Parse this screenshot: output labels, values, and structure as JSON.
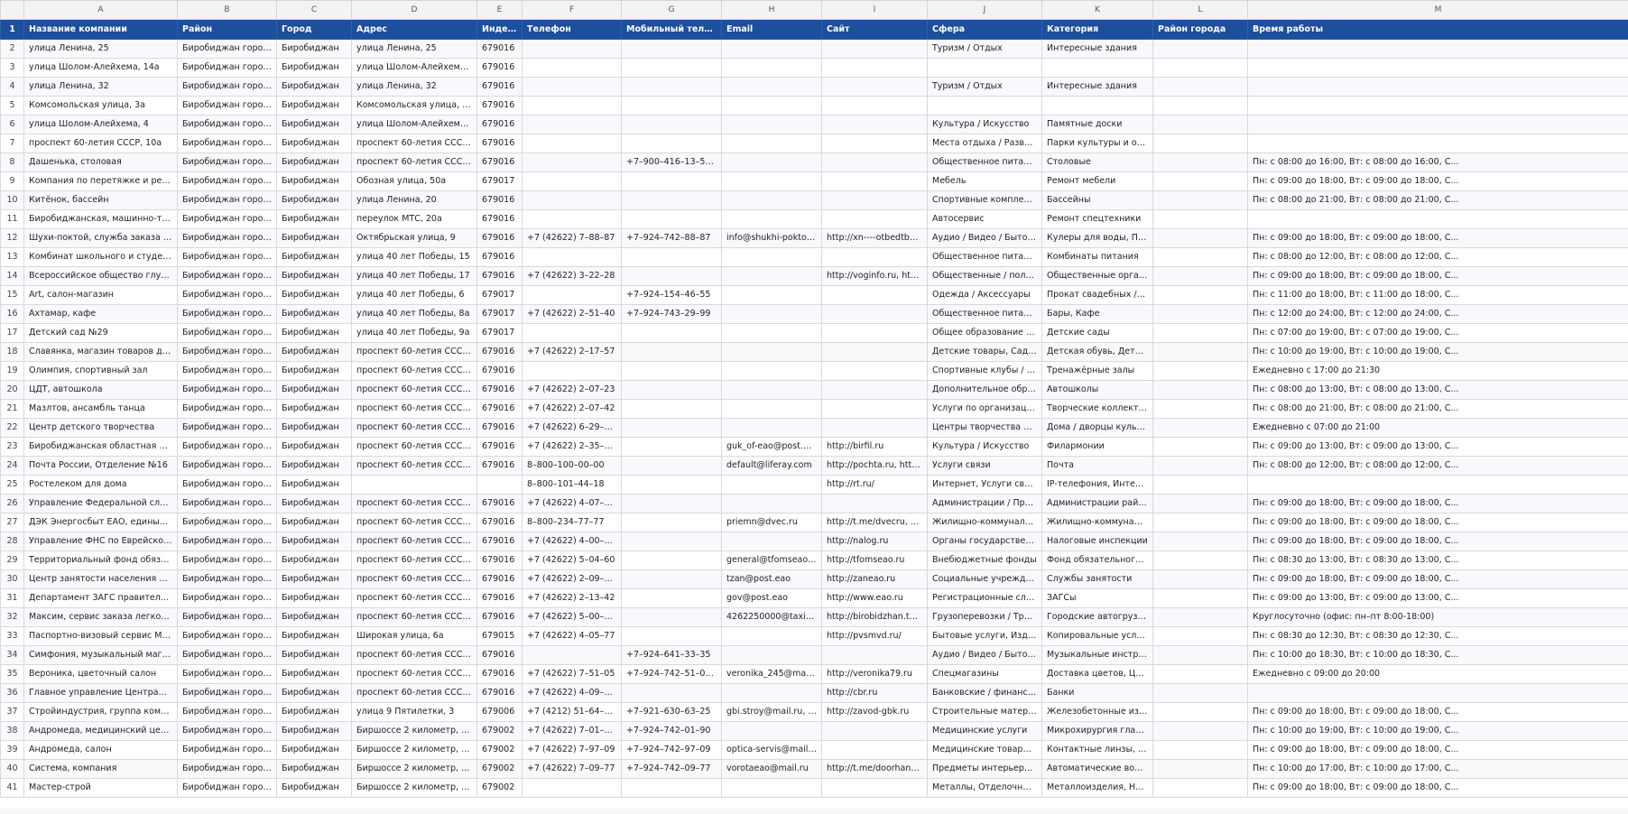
{
  "column_letters": [
    "A",
    "B",
    "C",
    "D",
    "E",
    "F",
    "G",
    "H",
    "I",
    "J",
    "K",
    "L",
    "M"
  ],
  "header_row": {
    "row_number": "1",
    "cells": [
      "Название компании",
      "Район",
      "Город",
      "Адрес",
      "Индекс",
      "Телефон",
      "Мобильный телефон",
      "Email",
      "Сайт",
      "Сфера",
      "Категория",
      "Район города",
      "Время работы"
    ]
  },
  "rows": [
    {
      "n": "2",
      "c": [
        "улица Ленина, 25",
        "Биробиджан городско...",
        "Биробиджан",
        "улица Ленина, 25",
        "679016",
        "",
        "",
        "",
        "",
        "Туризм / Отдых",
        "Интересные здания",
        "",
        ""
      ]
    },
    {
      "n": "3",
      "c": [
        "улица Шолом-Алейхема, 14а",
        "Биробиджан городско...",
        "Биробиджан",
        "улица Шолом-Алейхема, 14а",
        "679016",
        "",
        "",
        "",
        "",
        "",
        "",
        "",
        ""
      ]
    },
    {
      "n": "4",
      "c": [
        "улица Ленина, 32",
        "Биробиджан городско...",
        "Биробиджан",
        "улица Ленина, 32",
        "679016",
        "",
        "",
        "",
        "",
        "Туризм / Отдых",
        "Интересные здания",
        "",
        ""
      ]
    },
    {
      "n": "5",
      "c": [
        "Комсомольская улица, 3а",
        "Биробиджан городско...",
        "Биробиджан",
        "Комсомольская улица, 3а",
        "679016",
        "",
        "",
        "",
        "",
        "",
        "",
        "",
        ""
      ]
    },
    {
      "n": "6",
      "c": [
        "улица Шолом-Алейхема, 4",
        "Биробиджан городско...",
        "Биробиджан",
        "улица Шолом-Алейхема, 4",
        "679016",
        "",
        "",
        "",
        "",
        "Культура / Искусство",
        "Памятные доски",
        "",
        ""
      ]
    },
    {
      "n": "7",
      "c": [
        "проспект 60-летия СССР, 10а",
        "Биробиджан городско...",
        "Биробиджан",
        "проспект 60-летия СССР, 10а",
        "679016",
        "",
        "",
        "",
        "",
        "Места отдыха / Развлекате...",
        "Парки культуры и отдыха",
        "",
        ""
      ]
    },
    {
      "n": "8",
      "c": [
        "Дашенька, столовая",
        "Биробиджан городско...",
        "Биробиджан",
        "проспект 60-летия СССР, 12",
        "679016",
        "",
        "+7–900–416–13–58, +7...",
        "",
        "",
        "Общественное питание",
        "Столовые",
        "",
        "Пн: с 08:00 до 16:00, Вт: с 08:00 до 16:00, С..."
      ]
    },
    {
      "n": "9",
      "c": [
        "Компания по перетяжке и ремонту м...",
        "Биробиджан городско...",
        "Биробиджан",
        "Обозная улица, 50а",
        "679017",
        "",
        "",
        "",
        "",
        "Мебель",
        "Ремонт мебели",
        "",
        "Пн: с 09:00 до 18:00, Вт: с 09:00 до 18:00, С..."
      ]
    },
    {
      "n": "10",
      "c": [
        "Китёнок, бассейн",
        "Биробиджан городско...",
        "Биробиджан",
        "улица Ленина, 20",
        "679016",
        "",
        "",
        "",
        "",
        "Спортивные комплексы",
        "Бассейны",
        "",
        "Пн: с 08:00 до 21:00, Вт: с 08:00 до 21:00, С..."
      ]
    },
    {
      "n": "11",
      "c": [
        "Биробиджанская, машинно-технолог...",
        "Биробиджан городско...",
        "Биробиджан",
        "переулок МТС, 20а",
        "679016",
        "",
        "",
        "",
        "",
        "Автосервис",
        "Ремонт спецтехники",
        "",
        ""
      ]
    },
    {
      "n": "12",
      "c": [
        "Шухи-поктой, служба заказа артезиа...",
        "Биробиджан городско...",
        "Биробиджан",
        "Октябрьская улица, 9",
        "679016",
        "+7 (42622) 7–88–87",
        "+7–924–742–88–87",
        "info@shukhi-poktoi.ru, ...",
        "http://xn----otbedtbe0ad...",
        "Аудио / Видео / Бытовая т...",
        "Кулеры для воды, Питьева...",
        "",
        "Пн: с 09:00 до 18:00, Вт: с 09:00 до 18:00, С..."
      ]
    },
    {
      "n": "13",
      "c": [
        "Комбинат школьного и студенческог...",
        "Биробиджан городско...",
        "Биробиджан",
        "улица 40 лет Победы, 15",
        "679016",
        "",
        "",
        "",
        "",
        "Общественное питание",
        "Комбинаты питания",
        "",
        "Пн: с 08:00 до 12:00, Вт: с 08:00 до 12:00, С..."
      ]
    },
    {
      "n": "14",
      "c": [
        "Всероссийское общество глухих",
        "Биробиджан городско...",
        "Биробиджан",
        "улица 40 лет Победы, 17",
        "679016",
        "+7 (42622) 3–22–28",
        "",
        "",
        "http://voginfo.ru, http://v...",
        "Общественные / политиче...",
        "Общественные организац...",
        "",
        "Пн: с 09:00 до 18:00, Вт: с 09:00 до 18:00, С..."
      ]
    },
    {
      "n": "15",
      "c": [
        "Art, салон-магазин",
        "Биробиджан городско...",
        "Биробиджан",
        "улица 40 лет Победы, 6",
        "679017",
        "",
        "+7–924–154–46–55",
        "",
        "",
        "Одежда / Аксессуары",
        "Прокат свадебных / вечер...",
        "",
        "Пн: с 11:00 до 18:00, Вт: с 11:00 до 18:00, С..."
      ]
    },
    {
      "n": "16",
      "c": [
        "Ахтамар, кафе",
        "Биробиджан городско...",
        "Биробиджан",
        "улица 40 лет Победы, 8а",
        "679017",
        "+7 (42622) 2–51–40",
        "+7–924–743–29–99",
        "",
        "",
        "Общественное питание",
        "Бары, Кафе",
        "",
        "Пн: с 12:00 до 24:00, Вт: с 12:00 до 24:00, С..."
      ]
    },
    {
      "n": "17",
      "c": [
        "Детский сад №29",
        "Биробиджан городско...",
        "Биробиджан",
        "улица 40 лет Победы, 9а",
        "679017",
        "",
        "",
        "",
        "",
        "Общее образование / Цен...",
        "Детские сады",
        "",
        "Пн: с 07:00 до 19:00, Вт: с 07:00 до 19:00, С..."
      ]
    },
    {
      "n": "18",
      "c": [
        "Славянка, магазин товаров для дома",
        "Биробиджан городско...",
        "Биробиджан",
        "проспект 60-летия СССР, 11",
        "679016",
        "+7 (42622) 2–17–57",
        "",
        "",
        "",
        "Детские товары, Садово-х...",
        "Детская обувь, Детская од...",
        "",
        "Пн: с 10:00 до 19:00, Вт: с 10:00 до 19:00, С..."
      ]
    },
    {
      "n": "19",
      "c": [
        "Олимпия, спортивный зал",
        "Биробиджан городско...",
        "Биробиджан",
        "проспект 60-летия СССР, 11",
        "679016",
        "",
        "",
        "",
        "",
        "Спортивные клубы / школы",
        "Тренажёрные залы",
        "",
        "Ежедневно с 17:00 до 21:30"
      ]
    },
    {
      "n": "20",
      "c": [
        "ЦДТ, автошкола",
        "Биробиджан городско...",
        "Биробиджан",
        "проспект 60-летия СССР, 12",
        "679016",
        "+7 (42622) 2–07–23",
        "",
        "",
        "",
        "Дополнительное образов...",
        "Автошколы",
        "",
        "Пн: с 08:00 до 13:00, Вт: с 08:00 до 13:00, С..."
      ]
    },
    {
      "n": "21",
      "c": [
        "Мазлтов, ансамбль танца",
        "Биробиджан городско...",
        "Биробиджан",
        "проспект 60-летия СССР, 12",
        "679016",
        "+7 (42622) 2–07–42",
        "",
        "",
        "",
        "Услуги по организации пр...",
        "Творческие коллективы",
        "",
        "Пн: с 08:00 до 21:00, Вт: с 08:00 до 21:00, С..."
      ]
    },
    {
      "n": "22",
      "c": [
        "Центр детского творчества",
        "Биробиджан городско...",
        "Биробиджан",
        "проспект 60-летия СССР, 12",
        "679016",
        "+7 (42622) 6–29–42, +7...",
        "",
        "",
        "",
        "Центры творчества и досуга",
        "Дома / дворцы культуры",
        "",
        "Ежедневно с 07:00 до 21:00"
      ]
    },
    {
      "n": "23",
      "c": [
        "Биробиджанская областная филармо...",
        "Биробиджан городско...",
        "Биробиджан",
        "проспект 60-летия СССР, 14",
        "679016",
        "+7 (42622) 2–35–36, +7...",
        "",
        "guk_of-eao@post.eao, ...",
        "http://birfil.ru",
        "Культура / Искусство",
        "Филармонии",
        "",
        "Пн: с 09:00 до 13:00, Вт: с 09:00 до 13:00, С..."
      ]
    },
    {
      "n": "24",
      "c": [
        "Почта России, Отделение №16",
        "Биробиджан городско...",
        "Биробиджан",
        "проспект 60-летия СССР, 16",
        "679016",
        "8–800–100–00–00",
        "",
        "default@liferay.com",
        "http://pochta.ru, http://po...",
        "Услуги связи",
        "Почта",
        "",
        "Пн: с 08:00 до 12:00, Вт: с 08:00 до 12:00, С..."
      ]
    },
    {
      "n": "25",
      "c": [
        "Ростелеком для дома",
        "Биробиджан городско...",
        "Биробиджан",
        "",
        "",
        "8–800–101–44–18",
        "",
        "",
        "http://rt.ru/",
        "Интернет, Услуги связи",
        "IP-телефония, Интернет-п...",
        "",
        ""
      ]
    },
    {
      "n": "26",
      "c": [
        "Управление Федеральной службы по ...",
        "Биробиджан городско...",
        "Биробиджан",
        "проспект 60-летия СССР, 16",
        "679016",
        "+7 (42622) 4–07–12, +7...",
        "",
        "",
        "",
        "Администрации / Правите...",
        "Администрации районов /...",
        "",
        "Пн: с 09:00 до 18:00, Вт: с 09:00 до 18:00, С..."
      ]
    },
    {
      "n": "27",
      "c": [
        "ДЭК Энергосбыт ЕАО, единый расчет...",
        "Биробиджан городско...",
        "Биробиджан",
        "проспект 60-летия СССР, 22а",
        "679016",
        "8–800–234–77–77",
        "",
        "priemn@dvec.ru",
        "http://t.me/dvecru, http://...",
        "Жилищно-коммунальные ...",
        "Жилищно-коммунальные ...",
        "",
        "Пн: с 09:00 до 18:00, Вт: с 09:00 до 18:00, С..."
      ]
    },
    {
      "n": "28",
      "c": [
        "Управление ФНС по Еврейской автон...",
        "Биробиджан городско...",
        "Биробиджан",
        "проспект 60-летия СССР, 24",
        "679016",
        "+7 (42622) 4–00–67, +7...",
        "",
        "",
        "http://nalog.ru",
        "Органы государственного ...",
        "Налоговые инспекции",
        "",
        "Пн: с 09:00 до 18:00, Вт: с 09:00 до 18:00, С..."
      ]
    },
    {
      "n": "29",
      "c": [
        "Территориальный фонд обязательно...",
        "Биробиджан городско...",
        "Биробиджан",
        "проспект 60-летия СССР, 24",
        "679016",
        "+7 (42622) 5–04–60",
        "",
        "general@tfomseao.ru, tf...",
        "http://tfomseao.ru",
        "Внебюджетные фонды",
        "Фонд обязательного меди...",
        "",
        "Пн: с 08:30 до 13:00, Вт: с 08:30 до 13:00, С..."
      ]
    },
    {
      "n": "30",
      "c": [
        "Центр занятости населения Еврейско...",
        "Биробиджан городско...",
        "Биробиджан",
        "проспект 60-летия СССР, 24",
        "679016",
        "+7 (42622) 2–09–63, +7...",
        "",
        "tzan@post.eao",
        "http://zaneao.ru",
        "Социальные учреждения",
        "Службы занятости",
        "",
        "Пн: с 09:00 до 18:00, Вт: с 09:00 до 18:00, С..."
      ]
    },
    {
      "n": "31",
      "c": [
        "Департамент ЗАГС правительства Евр...",
        "Биробиджан городско...",
        "Биробиджан",
        "проспект 60-летия СССР, 26",
        "679016",
        "+7 (42622) 2–13–42",
        "",
        "gov@post.eao",
        "http://www.eao.ru",
        "Регистрационные службы",
        "ЗАГСы",
        "",
        "Пн: с 09:00 до 13:00, Вт: с 09:00 до 13:00, С..."
      ]
    },
    {
      "n": "32",
      "c": [
        "Максим, сервис заказа легкового и гр...",
        "Биробиджан городско...",
        "Биробиджан",
        "проспект 60-летия СССР, 3",
        "679016",
        "+7 (42622) 5–00–00, +7...",
        "",
        "4262250000@taximaxi...",
        "http://birobidzhan.taxima...",
        "Грузоперевозки / Трансло...",
        "Городские автогрузопере...",
        "",
        "Круглосуточно (офис: пн–пт 8:00-18:00)"
      ]
    },
    {
      "n": "33",
      "c": [
        "Паспортно-визовый сервис МВД Рос...",
        "Биробиджан городско...",
        "Биробиджан",
        "Широкая улица, 6а",
        "679015",
        "+7 (42622) 4–05–77",
        "",
        "",
        "http://pvsmvd.ru/",
        "Бытовые услуги, Издатель...",
        "Копировальные услуги, М...",
        "",
        "Пн: с 08:30 до 12:30, Вт: с 08:30 до 12:30, С..."
      ]
    },
    {
      "n": "34",
      "c": [
        "Симфония, музыкальный магазин",
        "Биробиджан городско...",
        "Биробиджан",
        "проспект 60-летия СССР, 3",
        "679016",
        "",
        "+7–924–641–33–35",
        "",
        "",
        "Аудио / Видео / Бытовая т...",
        "Музыкальные инструменты",
        "",
        "Пн: с 10:00 до 18:30, Вт: с 10:00 до 18:30, С..."
      ]
    },
    {
      "n": "35",
      "c": [
        "Вероника, цветочный салон",
        "Биробиджан городско...",
        "Биробиджан",
        "проспект 60-летия СССР, 3",
        "679016",
        "+7 (42622) 7–51–05",
        "+7–924–742–51–05, +7...",
        "veronika_245@mail.ru",
        "http://veronika79.ru",
        "Спецмагазины",
        "Доставка цветов, Цветы",
        "",
        "Ежедневно с 09:00 до 20:00"
      ]
    },
    {
      "n": "36",
      "c": [
        "Главное управление Центрального Б...",
        "Биробиджан городско...",
        "Биробиджан",
        "проспект 60-летия СССР, 5",
        "679016",
        "+7 (42622) 4–09–72, +7...",
        "",
        "",
        "http://cbr.ru",
        "Банковские / финансовые ...",
        "Банки",
        "",
        ""
      ]
    },
    {
      "n": "37",
      "c": [
        "Стройиндустрия, группа компаний",
        "Биробиджан городско...",
        "Биробиджан",
        "улица 9 Пятилетки, 3",
        "679006",
        "+7 (4212) 51–64–04, +7...",
        "+7–921–630–63–25",
        "gbi.stroy@mail.ru, mail...",
        "http://zavod-gbk.ru",
        "Строительные материалы ...",
        "Железобетонные изделия",
        "",
        "Пн: с 09:00 до 18:00, Вт: с 09:00 до 18:00, С..."
      ]
    },
    {
      "n": "38",
      "c": [
        "Андромеда, медицинский центр",
        "Биробиджан городско...",
        "Биробиджан",
        "Биршоссе 2 километр, 17б",
        "679002",
        "+7 (42622) 7–01–90, +7...",
        "+7–924–742–01–90",
        "",
        "",
        "Медицинские услуги",
        "Микрохирургия глаза, Офт...",
        "",
        "Пн: с 10:00 до 19:00, Вт: с 10:00 до 19:00, С..."
      ]
    },
    {
      "n": "39",
      "c": [
        "Андромеда, салон",
        "Биробиджан городско...",
        "Биробиджан",
        "Биршоссе 2 километр, 17б",
        "679002",
        "+7 (42622) 7–97–09",
        "+7–924–742–97–09",
        "optica-servis@mail.ru",
        "",
        "Медицинские товары, Оде...",
        "Контактные линзы, Оптика...",
        "",
        "Пн: с 09:00 до 18:00, Вт: с 09:00 до 18:00, С..."
      ]
    },
    {
      "n": "40",
      "c": [
        "Система, компания",
        "Биробиджан городско...",
        "Биробиджан",
        "Биршоссе 2 километр, 23",
        "679002",
        "+7 (42622) 7–09–77",
        "+7–924–742–09–77",
        "vorotaeao@mail.ru",
        "http://t.me/doorhan_biro...",
        "Предметы интерьера / экс...",
        "Автоматические ворота /...",
        "",
        "Пн: с 10:00 до 17:00, Вт: с 10:00 до 17:00, С..."
      ]
    },
    {
      "n": "41",
      "c": [
        "Мастер-строй",
        "Биробиджан городско...",
        "Биробиджан",
        "Биршоссе 2 километр, 23",
        "679002",
        "",
        "",
        "",
        "",
        "Металлы, Отделочные мат...",
        "Металлоизделия, Напольн...",
        "",
        "Пн: с 09:00 до 18:00, Вт: с 09:00 до 18:00, С..."
      ]
    }
  ],
  "colors": {
    "header_bg": "#1c4f9c",
    "header_text": "#ffffff",
    "grid": "#d9d9d9"
  }
}
